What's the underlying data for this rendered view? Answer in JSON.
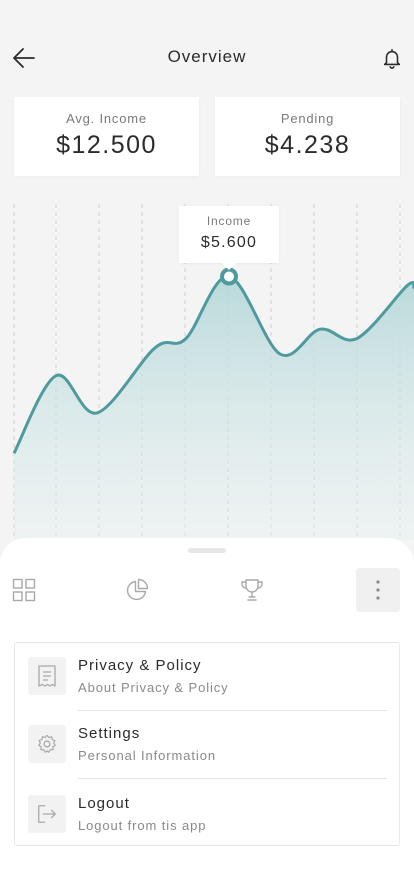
{
  "header": {
    "title": "Overview",
    "back_icon": "arrow-left-icon",
    "notification_icon": "bell-icon"
  },
  "stats": [
    {
      "label": "Avg. Income",
      "value": "$12.500"
    },
    {
      "label": "Pending",
      "value": "$4.238"
    }
  ],
  "chart_data": {
    "type": "area",
    "title": "",
    "series": [
      {
        "values": [
          28,
          53,
          41,
          62,
          65,
          85,
          60,
          68,
          65,
          82
        ]
      }
    ],
    "highlight": {
      "label": "Income",
      "value": "$5.600",
      "index": 5
    },
    "ylim": [
      0,
      100
    ],
    "grid": "vertical dashed",
    "colors": {
      "line": "#4e9a9e",
      "fill": "#bcdcdc"
    }
  },
  "tabs": [
    {
      "name": "dashboard",
      "icon": "grid-icon"
    },
    {
      "name": "statistics",
      "icon": "pie-chart-icon"
    },
    {
      "name": "achievements",
      "icon": "trophy-icon"
    },
    {
      "name": "more",
      "icon": "more-vertical-icon",
      "active": true
    }
  ],
  "menu": [
    {
      "title": "Privacy & Policy",
      "subtitle": "About Privacy & Policy",
      "icon": "receipt-icon"
    },
    {
      "title": "Settings",
      "subtitle": "Personal Information",
      "icon": "gear-icon"
    },
    {
      "title": "Logout",
      "subtitle": "Logout from tis app",
      "icon": "logout-icon"
    }
  ],
  "colors": {
    "accent": "#4e9a9e",
    "background": "#f4f4f4"
  }
}
